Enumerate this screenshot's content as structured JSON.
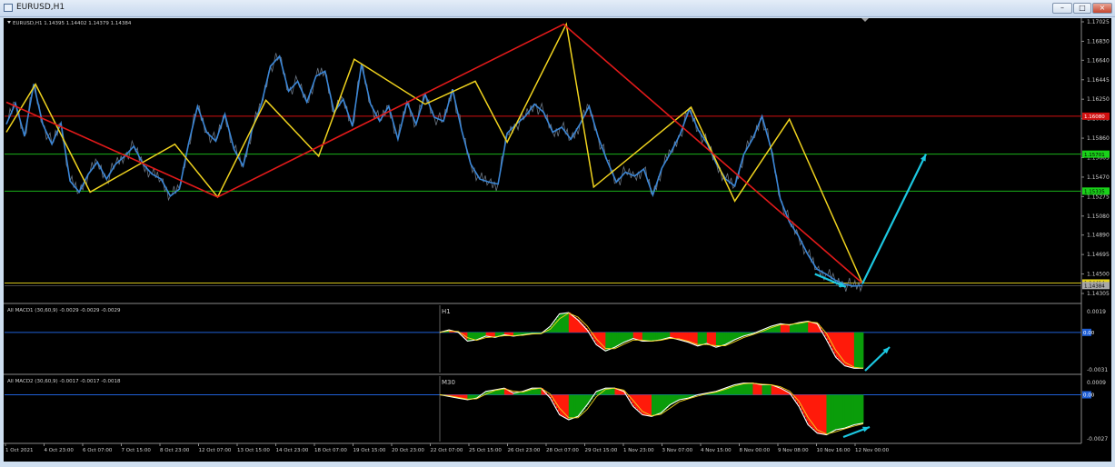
{
  "window": {
    "title": "EURUSD,H1"
  },
  "main": {
    "header": "EURUSD,H1 1.14395 1.14402 1.14379 1.14384",
    "price_ticks": [
      "1.17025",
      "1.16830",
      "1.16640",
      "1.16445",
      "1.16250",
      "1.16055",
      "1.15860",
      "1.15665",
      "1.15470",
      "1.15275",
      "1.15080",
      "1.14890",
      "1.14695",
      "1.14500",
      "1.14305"
    ],
    "ylim": [
      1.14305,
      1.17025
    ],
    "hlines": [
      {
        "price": 1.1608,
        "color": "#d11010",
        "label": "1.16080",
        "label_bg": "#d11010",
        "label_color": "#ffffff"
      },
      {
        "price": 1.157,
        "color": "#19b219",
        "label": "1.15701",
        "label_bg": "#19d119",
        "label_color": "#000000"
      },
      {
        "price": 1.1533,
        "color": "#19b219",
        "label": "1.15335",
        "label_bg": "#19d119",
        "label_color": "#000000"
      },
      {
        "price": 1.1441,
        "color": "#d4c21a",
        "label": "1.14414",
        "label_bg": "#e4d21a",
        "label_color": "#000000"
      }
    ],
    "current_price_label": "1.14384",
    "x_axis_labels": [
      "1 Oct 2021",
      "4 Oct 23:00",
      "6 Oct 07:00",
      "7 Oct 15:00",
      "8 Oct 23:00",
      "12 Oct 07:00",
      "13 Oct 15:00",
      "14 Oct 23:00",
      "18 Oct 07:00",
      "19 Oct 15:00",
      "20 Oct 23:00",
      "22 Oct 07:00",
      "25 Oct 15:00",
      "26 Oct 23:00",
      "28 Oct 07:00",
      "29 Oct 15:00",
      "1 Nov 23:00",
      "3 Nov 07:00",
      "4 Nov 15:00",
      "8 Nov 00:00",
      "9 Nov 08:00",
      "10 Nov 16:00",
      "12 Nov 00:00"
    ]
  },
  "chart_data": [
    {
      "type": "line",
      "name": "EURUSD H1 price with zigzag",
      "x_index": [
        0,
        10,
        20,
        30,
        40,
        50,
        60,
        70,
        80,
        90,
        100,
        110,
        120,
        130,
        140,
        150,
        160,
        170,
        180,
        190,
        200,
        210,
        220,
        230,
        240,
        250,
        260,
        270,
        280,
        290,
        300,
        310,
        320,
        330,
        340,
        350,
        360,
        370,
        380,
        390,
        400,
        410,
        420,
        430,
        440,
        450,
        460,
        470,
        480,
        490,
        500,
        510,
        520,
        530,
        540,
        550,
        560,
        570,
        580,
        590,
        600,
        610,
        620,
        630,
        640,
        650,
        660,
        670,
        680,
        690,
        700,
        710,
        720,
        730,
        740,
        750,
        760,
        770,
        780,
        790,
        800,
        810,
        820,
        830,
        840,
        850,
        860,
        870,
        880,
        890,
        900,
        910,
        920,
        930,
        940
      ],
      "price": [
        1.16,
        1.1621,
        1.1588,
        1.164,
        1.16,
        1.158,
        1.1601,
        1.1543,
        1.1532,
        1.155,
        1.1562,
        1.1545,
        1.156,
        1.1568,
        1.1578,
        1.156,
        1.155,
        1.1545,
        1.1528,
        1.1535,
        1.158,
        1.1618,
        1.1592,
        1.1583,
        1.161,
        1.1575,
        1.1558,
        1.1595,
        1.162,
        1.1658,
        1.1668,
        1.1633,
        1.1643,
        1.1622,
        1.1648,
        1.1653,
        1.1612,
        1.1625,
        1.1598,
        1.166,
        1.162,
        1.1603,
        1.1618,
        1.1585,
        1.1622,
        1.16,
        1.163,
        1.1607,
        1.1603,
        1.1635,
        1.1594,
        1.156,
        1.1545,
        1.1542,
        1.154,
        1.1591,
        1.16,
        1.1608,
        1.162,
        1.1612,
        1.1592,
        1.1597,
        1.1585,
        1.16,
        1.1618,
        1.1587,
        1.1563,
        1.1542,
        1.1552,
        1.1548,
        1.1555,
        1.1529,
        1.1556,
        1.1572,
        1.159,
        1.1615,
        1.1594,
        1.158,
        1.156,
        1.1545,
        1.1538,
        1.157,
        1.1586,
        1.1608,
        1.1575,
        1.1525,
        1.1502,
        1.1488,
        1.147,
        1.1455,
        1.145,
        1.1444,
        1.144,
        1.1438,
        1.14384
      ],
      "zigzag_yellow": [
        [
          0,
          1.1592
        ],
        [
          32,
          1.164
        ],
        [
          92,
          1.1532
        ],
        [
          185,
          1.158
        ],
        [
          232,
          1.1527
        ],
        [
          285,
          1.1624
        ],
        [
          343,
          1.1568
        ],
        [
          382,
          1.1665
        ],
        [
          460,
          1.162
        ],
        [
          515,
          1.1643
        ],
        [
          550,
          1.1582
        ],
        [
          615,
          1.17
        ],
        [
          645,
          1.1537
        ],
        [
          752,
          1.1617
        ],
        [
          800,
          1.1523
        ],
        [
          860,
          1.1605
        ],
        [
          940,
          1.1441
        ]
      ],
      "zigzag_red": [
        [
          0,
          1.1622
        ],
        [
          232,
          1.1527
        ],
        [
          612,
          1.17
        ],
        [
          940,
          1.1441
        ]
      ],
      "arrows_cyan": [
        [
          [
            888,
            1.145
          ],
          [
            922,
            1.1437
          ]
        ],
        [
          [
            940,
            1.144
          ],
          [
            1010,
            1.157
          ]
        ]
      ]
    },
    {
      "type": "area",
      "title": "All MACD1 (30,60,9) -0.0029 -0.0029 -0.0029",
      "timeframe": "H1",
      "yticks": [
        "0.0019",
        "0.00",
        "-0.0031"
      ],
      "ylim": [
        -0.0031,
        0.0019
      ],
      "zero_label": "0.00",
      "x": [
        0,
        10,
        20,
        30,
        40,
        50,
        60,
        70,
        80,
        90,
        100,
        110,
        120,
        130,
        140,
        150,
        160,
        170,
        180,
        190,
        200,
        210,
        220,
        230,
        240,
        250,
        260,
        270,
        280,
        290,
        300,
        310,
        320,
        330,
        340,
        350,
        360,
        370,
        380,
        390,
        400,
        410,
        420,
        430,
        440,
        450,
        460
      ],
      "values": [
        0,
        0.0002,
        0,
        -0.0007,
        -0.0006,
        -0.0003,
        -0.0004,
        -0.0002,
        -0.0003,
        -0.0002,
        -0.0001,
        -0.0001,
        0.0005,
        0.0015,
        0.0016,
        0.001,
        0.0002,
        -0.001,
        -0.0015,
        -0.0012,
        -0.0008,
        -0.0005,
        -0.0007,
        -0.0007,
        -0.0006,
        -0.0004,
        -0.0006,
        -0.0008,
        -0.0011,
        -0.0009,
        -0.0012,
        -0.001,
        -0.0006,
        -0.0003,
        -0.0001,
        0.0002,
        0.0005,
        0.0007,
        0.0006,
        0.0008,
        0.0009,
        0.0007,
        -0.0006,
        -0.002,
        -0.0027,
        -0.0029,
        -0.0029
      ]
    },
    {
      "type": "area",
      "title": "All MACD2 (30,60,9) -0.0017 -0.0017 -0.0018",
      "timeframe": "M30",
      "yticks": [
        "0.0009",
        "0.00",
        "-0.0027"
      ],
      "ylim": [
        -0.0027,
        0.0009
      ],
      "zero_label": "0.00",
      "x": [
        0,
        10,
        20,
        30,
        40,
        50,
        60,
        70,
        80,
        90,
        100,
        110,
        120,
        130,
        140,
        150,
        160,
        170,
        180,
        190,
        200,
        210,
        220,
        230,
        240,
        250,
        260,
        270,
        280,
        290,
        300,
        310,
        320,
        330,
        340,
        350,
        360,
        370,
        380,
        390,
        400,
        410,
        420,
        430,
        440,
        450,
        460
      ],
      "values": [
        0,
        -0.0001,
        -0.0002,
        -0.0003,
        -0.0002,
        0.0002,
        0.0003,
        0.0004,
        0.0001,
        0.0002,
        0.0004,
        0.0004,
        -0.0002,
        -0.0012,
        -0.0015,
        -0.0013,
        -0.0006,
        0.0002,
        0.0004,
        0.0004,
        0.0002,
        -0.0007,
        -0.0012,
        -0.0013,
        -0.0011,
        -0.0006,
        -0.0003,
        -0.0002,
        0.0,
        0.0001,
        0.0002,
        0.0004,
        0.0006,
        0.0007,
        0.0007,
        0.0006,
        0.0006,
        0.0004,
        0.0001,
        -0.0007,
        -0.0018,
        -0.0023,
        -0.0024,
        -0.0021,
        -0.002,
        -0.0018,
        -0.0017
      ]
    }
  ],
  "colors": {
    "bg": "#000000",
    "grid_axis": "#8a8a8a",
    "price": "#7e8a99",
    "blue": "#3b86d6",
    "yellow": "#f0d31e",
    "red": "#e21a1a",
    "cyan": "#1cc8e2",
    "macd_pos": "#0a9d0a",
    "macd_neg": "#ff1a0a",
    "zero_line": "#1f5fd6"
  }
}
